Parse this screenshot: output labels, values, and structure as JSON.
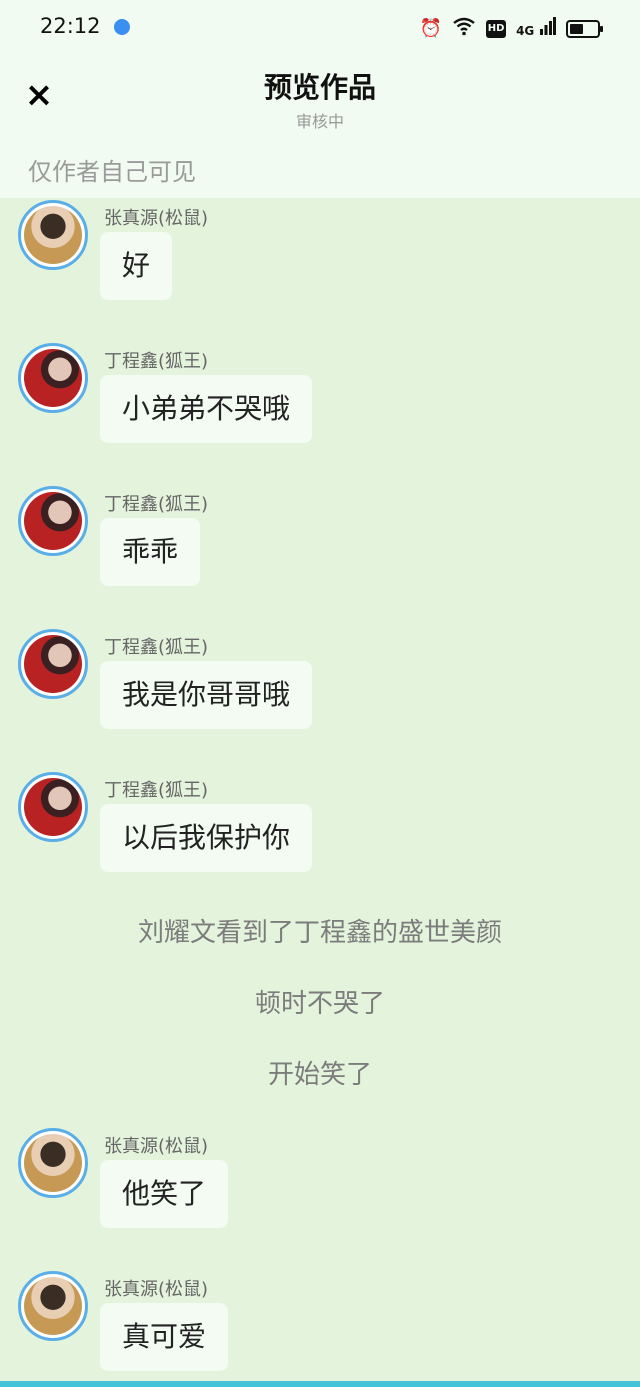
{
  "status_bar": {
    "time": "22:12",
    "icons": [
      "app-icon",
      "alarm-icon",
      "wifi-icon",
      "hd-icon",
      "signal-4g-icon",
      "battery-icon"
    ],
    "hd_label": "HD",
    "network_label": "4G",
    "battery_level": 0.5
  },
  "header": {
    "close_icon": "×",
    "title": "预览作品",
    "subtitle": "审核中",
    "visibility_note": "仅作者自己可见"
  },
  "messages": [
    {
      "sender": "张真源(松鼠)",
      "text": "好",
      "avatar": "zhang"
    },
    {
      "sender": "丁程鑫(狐王)",
      "text": "小弟弟不哭哦",
      "avatar": "ding"
    },
    {
      "sender": "丁程鑫(狐王)",
      "text": "乖乖",
      "avatar": "ding"
    },
    {
      "sender": "丁程鑫(狐王)",
      "text": "我是你哥哥哦",
      "avatar": "ding"
    },
    {
      "sender": "丁程鑫(狐王)",
      "text": "以后我保护你",
      "avatar": "ding"
    }
  ],
  "narration": [
    "刘耀文看到了丁程鑫的盛世美颜",
    "顿时不哭了",
    "开始笑了"
  ],
  "messages_after": [
    {
      "sender": "张真源(松鼠)",
      "text": "他笑了",
      "avatar": "zhang"
    },
    {
      "sender": "张真源(松鼠)",
      "text": "真可爱",
      "avatar": "zhang"
    }
  ],
  "colors": {
    "page_background": "#e4f3dc",
    "header_background": "#f1fbf1",
    "avatar_ring": "#5aaee8",
    "bubble": "#f3fbf3"
  }
}
